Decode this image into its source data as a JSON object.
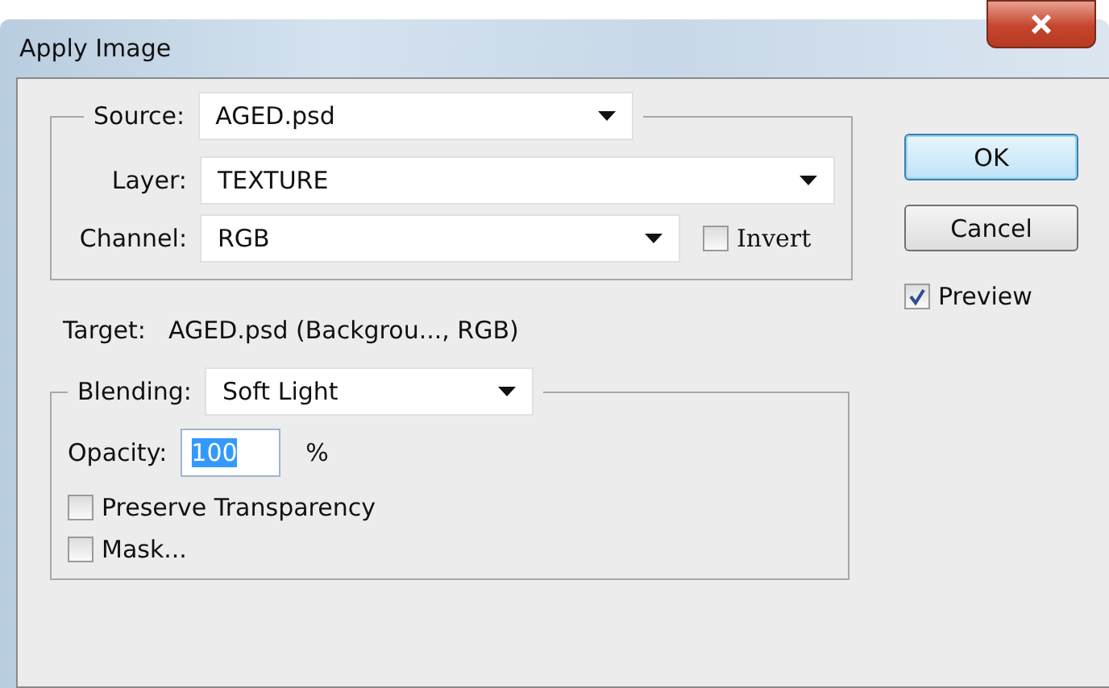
{
  "window": {
    "title": "Apply Image"
  },
  "source": {
    "label": "Source:",
    "value": "AGED.psd"
  },
  "layer": {
    "label": "Layer:",
    "value": "TEXTURE"
  },
  "channel": {
    "label": "Channel:",
    "value": "RGB"
  },
  "invert": {
    "label": "Invert",
    "checked": false
  },
  "target": {
    "label": "Target:",
    "value": "AGED.psd (Backgrou..., RGB)"
  },
  "blending": {
    "label": "Blending:",
    "value": "Soft Light"
  },
  "opacity": {
    "label": "Opacity:",
    "value": "100",
    "unit": "%"
  },
  "options": [
    {
      "label": "Preserve Transparency",
      "checked": false
    },
    {
      "label": "Mask...",
      "checked": false
    }
  ],
  "buttons": [
    {
      "label": "OK",
      "default": true
    },
    {
      "label": "Cancel",
      "default": false
    }
  ],
  "preview": {
    "label": "Preview",
    "checked": true
  }
}
